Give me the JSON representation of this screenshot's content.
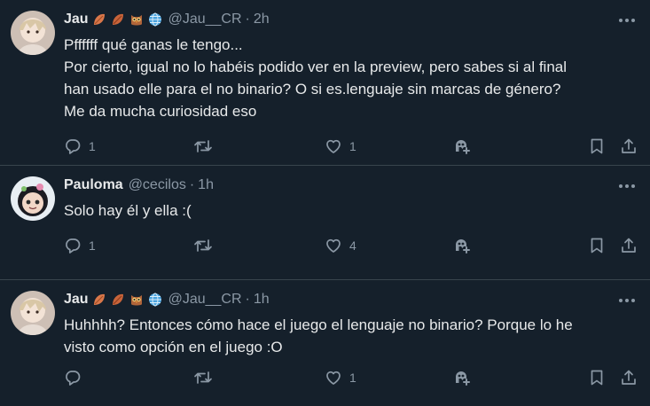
{
  "tweets": [
    {
      "name": "Jau",
      "badges": [
        "leaf-emoji",
        "leaf-emoji",
        "owl-emoji",
        "globe-emoji"
      ],
      "handle": "@Jau__CR",
      "dot": "·",
      "time": "2h",
      "lines": [
        "Pffffff qué ganas le tengo...",
        "Por cierto, igual no lo habéis podido ver en la preview, pero sabes si al final",
        "han usado elle para el no binario? O si es.lenguaje sin marcas de género?",
        "Me da mucha curiosidad eso"
      ],
      "reply_count": "1",
      "retweet_count": "",
      "like_count": "1"
    },
    {
      "name": "Pauloma",
      "badges": [],
      "handle": "@cecilos",
      "dot": "·",
      "time": "1h",
      "lines": [
        "Solo hay él y ella :("
      ],
      "reply_count": "1",
      "retweet_count": "",
      "like_count": "4"
    },
    {
      "name": "Jau",
      "badges": [
        "leaf-emoji",
        "leaf-emoji",
        "owl-emoji",
        "globe-emoji"
      ],
      "handle": "@Jau__CR",
      "dot": "·",
      "time": "1h",
      "lines": [
        "Huhhhh? Entonces cómo hace el juego el lenguaje no binario? Porque lo he",
        "visto como opción en el juego :O"
      ],
      "reply_count": "",
      "retweet_count": "",
      "like_count": "1"
    }
  ],
  "colors": {
    "background": "#15202b",
    "text": "#e7e9ea",
    "secondary": "#8b98a5",
    "divider": "#38444d"
  }
}
